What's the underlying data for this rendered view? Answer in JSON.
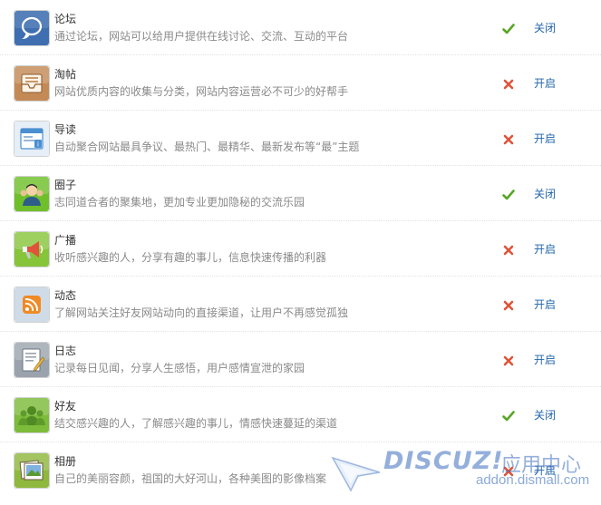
{
  "modules": [
    {
      "name": "论坛",
      "desc": "通过论坛，网站可以给用户提供在线讨论、交流、互动的平台",
      "status": "enabled",
      "toggle_label": "关闭",
      "icon": "forum-speech-bubble-icon",
      "icon_color": "#3f6fb0"
    },
    {
      "name": "淘帖",
      "desc": "网站优质内容的收集与分类，网站内容运营必不可少的好帮手",
      "status": "disabled",
      "toggle_label": "开启",
      "icon": "collection-inbox-icon",
      "icon_color": "#c48a56"
    },
    {
      "name": "导读",
      "desc": "自动聚合网站最具争议、最热门、最精华、最新发布等“最”主题",
      "status": "disabled",
      "toggle_label": "开启",
      "icon": "guide-window-icon",
      "icon_color": "#4a8fd0"
    },
    {
      "name": "圈子",
      "desc": "志同道合者的聚集地，更加专业更加隐秘的交流乐园",
      "status": "enabled",
      "toggle_label": "关闭",
      "icon": "group-users-icon",
      "icon_color": "#6fbf2a"
    },
    {
      "name": "广播",
      "desc": "收听感兴趣的人，分享有趣的事儿，信息快速传播的利器",
      "status": "disabled",
      "toggle_label": "开启",
      "icon": "broadcast-megaphone-icon",
      "icon_color": "#86c43a"
    },
    {
      "name": "动态",
      "desc": "了解网站关注好友网站动向的直接渠道，让用户不再感觉孤独",
      "status": "disabled",
      "toggle_label": "开启",
      "icon": "feed-rss-icon",
      "icon_color": "#d0dbe8"
    },
    {
      "name": "日志",
      "desc": "记录每日见闻，分享人生感悟，用户感情宣泄的家园",
      "status": "disabled",
      "toggle_label": "开启",
      "icon": "blog-notepad-icon",
      "icon_color": "#9aa3ad"
    },
    {
      "name": "好友",
      "desc": "结交感兴趣的人，了解感兴趣的事儿，情感快速蔓延的渠道",
      "status": "enabled",
      "toggle_label": "关闭",
      "icon": "friends-people-icon",
      "icon_color": "#7dbb3a"
    },
    {
      "name": "相册",
      "desc": "自己的美丽容颜，祖国的大好河山，各种美图的影像档案",
      "status": "disabled",
      "toggle_label": "开启",
      "icon": "album-photo-icon",
      "icon_color": "#8fb83e"
    }
  ],
  "status_colors": {
    "enabled": "#5aa628",
    "disabled": "#e0533a"
  },
  "link_color": "#2366a8",
  "watermark": {
    "brand": "DISCUZ!",
    "center": "应用中心",
    "url": "addon.dismall.com"
  }
}
